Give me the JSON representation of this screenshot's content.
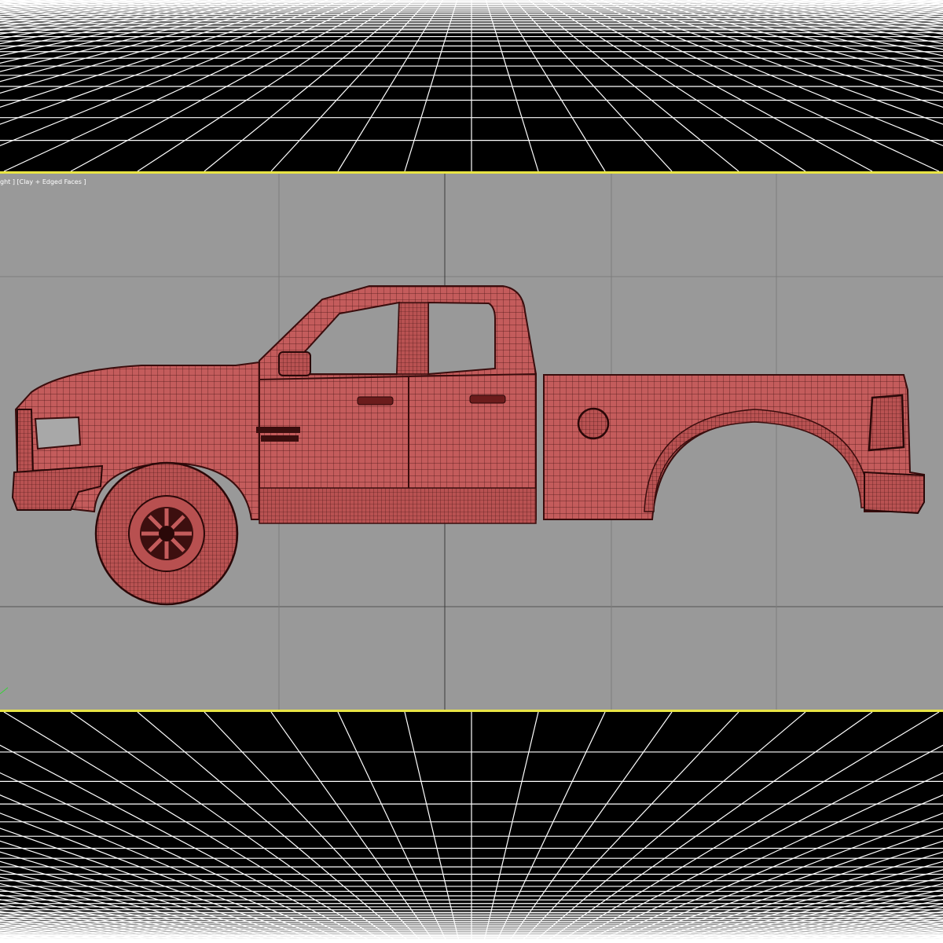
{
  "viewport": {
    "label": "ght ] [Clay + Edged Faces ]",
    "shading_mode": "Clay + Edged Faces",
    "border_color": "#e9e545",
    "background_color": "#999999"
  },
  "model": {
    "name": "pickup-truck",
    "mesh_color": "#c25a5a",
    "wire_color": "#3a0d0d",
    "badge_icon": "ram-badge-icon"
  },
  "floor": {
    "color": "#000000",
    "grid_color": "#ffffff"
  }
}
